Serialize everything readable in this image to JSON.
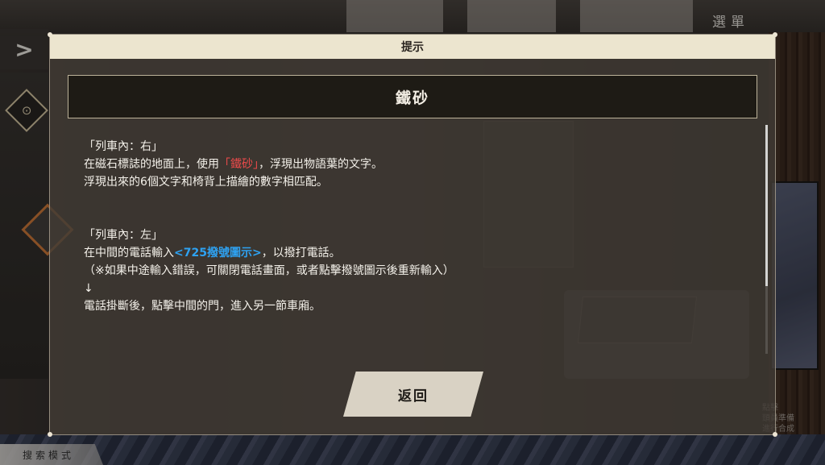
{
  "hud": {
    "menu_label": "選單",
    "back_glyph": ">",
    "search_mode_label": "搜索模式",
    "hint_lines": [
      "點擊",
      "頭員準備",
      "進行合成"
    ]
  },
  "dialog": {
    "header": "提示",
    "title": "鐵砂",
    "section1": {
      "heading": "「列車內：右」",
      "line1_pre": "在磁石標誌的地面上，使用",
      "line1_highlight": "「鐵砂」",
      "line1_post": "，浮現出物語葉的文字。",
      "line2": "浮現出來的6個文字和椅背上描繪的數字相匹配。"
    },
    "section2": {
      "heading": "「列車內：左」",
      "line1_pre": "在中間的電話輸入",
      "line1_highlight": "<725撥號圖示>",
      "line1_post": "，以撥打電話。",
      "line2": "（※如果中途輸入錯誤，可關閉電話畫面，或者點擊撥號圖示後重新輸入）",
      "arrow": "↓",
      "line3": "電話掛斷後，點擊中間的門，進入另一節車廂。"
    },
    "return_label": "返回"
  },
  "colors": {
    "highlight_red": "#ef4b4b",
    "highlight_blue": "#2ea2f2",
    "header_bg": "#ece5cf",
    "title_bg": "#1e1b15"
  },
  "icons": {
    "back": "chevron-right-icon",
    "map": "location-pin-icon",
    "side": "diamond-icon"
  }
}
